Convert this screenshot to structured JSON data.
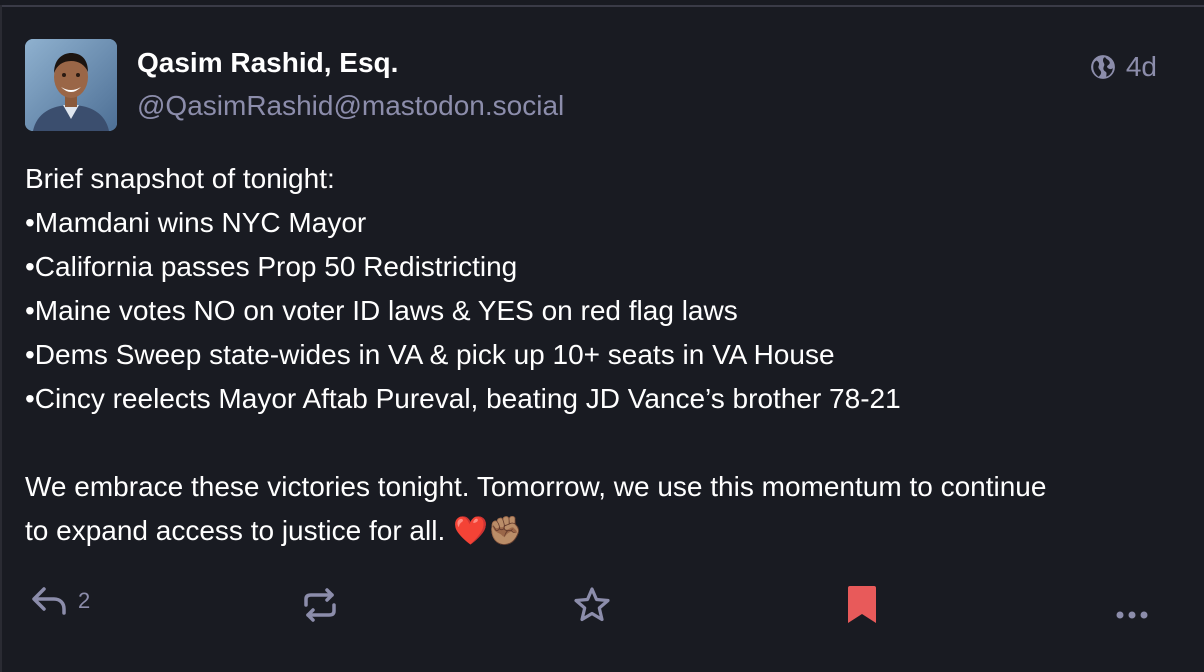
{
  "post": {
    "author": {
      "display_name": "Qasim Rashid, Esq.",
      "handle": "@QasimRashid@mastodon.social"
    },
    "visibility_icon": "globe-icon",
    "time_ago": "4d",
    "lines": [
      "Brief snapshot of tonight:",
      "•Mamdani wins NYC Mayor",
      "•California passes Prop 50 Redistricting",
      "•Maine votes NO on voter ID laws & YES on red flag laws",
      "•Dems Sweep state-wides in VA & pick up 10+ seats in VA House",
      "•Cincy reelects Mayor Aftab Pureval, beating JD Vance’s brother 78-21"
    ],
    "closing_lines": [
      "We embrace these victories tonight. Tomorrow, we use this momentum to continue",
      "to expand access to justice for all. ❤️✊🏽"
    ],
    "actions": {
      "reply_count": "2",
      "bookmark_color": "#e85a5a"
    }
  }
}
